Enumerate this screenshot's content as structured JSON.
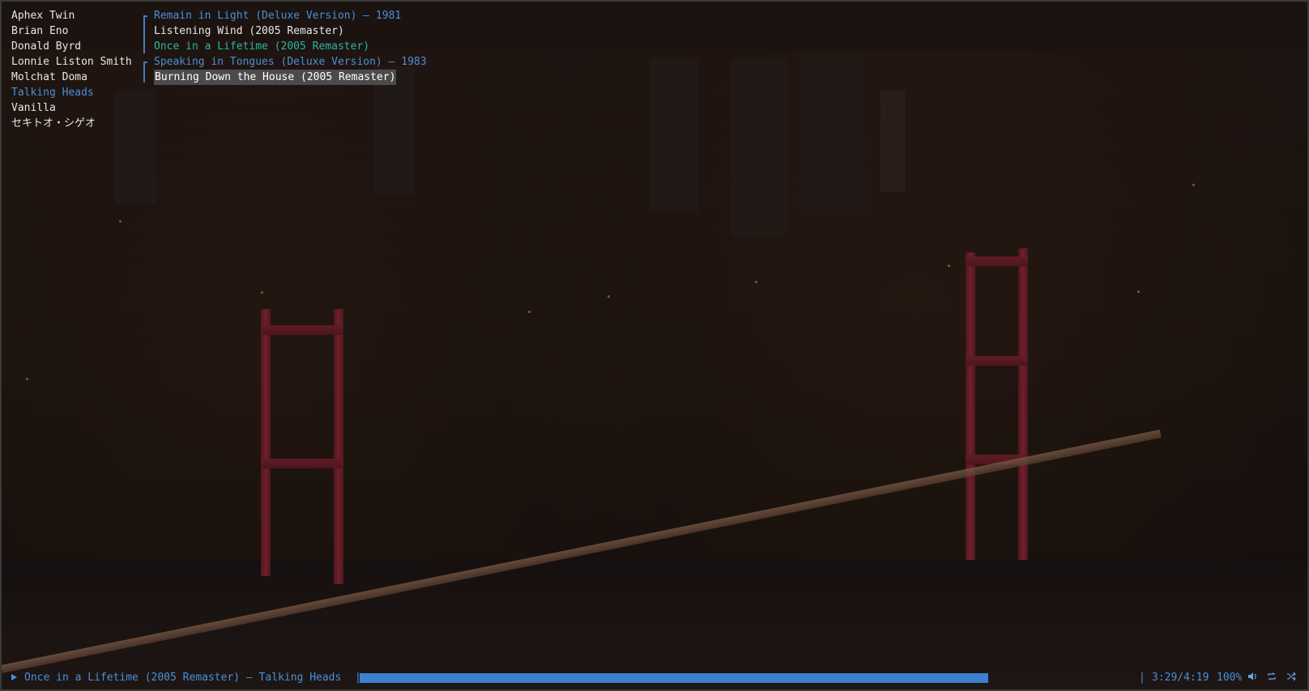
{
  "artists": [
    {
      "name": "Aphex Twin",
      "active": false
    },
    {
      "name": "Brian Eno",
      "active": false
    },
    {
      "name": "Donald Byrd",
      "active": false
    },
    {
      "name": "Lonnie Liston Smith",
      "active": false
    },
    {
      "name": "Molchat Doma",
      "active": false
    },
    {
      "name": "Talking Heads",
      "active": true
    },
    {
      "name": "Vanilla",
      "active": false
    },
    {
      "name": "セキトオ・シゲオ",
      "active": false
    }
  ],
  "library": [
    {
      "kind": "album",
      "text": "Remain in Light (Deluxe Version) — 1981"
    },
    {
      "kind": "track",
      "text": "Listening Wind (2005 Remaster)",
      "state": "normal"
    },
    {
      "kind": "track",
      "text": "Once in a Lifetime (2005 Remaster)",
      "state": "playing"
    },
    {
      "kind": "album",
      "text": "Speaking in Tongues (Deluxe Version) — 1983"
    },
    {
      "kind": "track",
      "text": "Burning Down the House (2005 Remaster)",
      "state": "selected"
    }
  ],
  "player": {
    "now_playing": "Once in a Lifetime (2005 Remaster) — Talking Heads",
    "separator": "|",
    "time": "3:29/4:19",
    "volume": "100%",
    "progress_fraction": 0.805
  },
  "colors": {
    "accent": "#4a90d9",
    "playing": "#2fb3a0",
    "selected_bg": "#4b4b4b",
    "progress": "#3d7fd0"
  },
  "icons": {
    "play": "play-icon",
    "volume": "volume-icon",
    "repeat": "repeat-icon",
    "shuffle": "shuffle-icon"
  }
}
